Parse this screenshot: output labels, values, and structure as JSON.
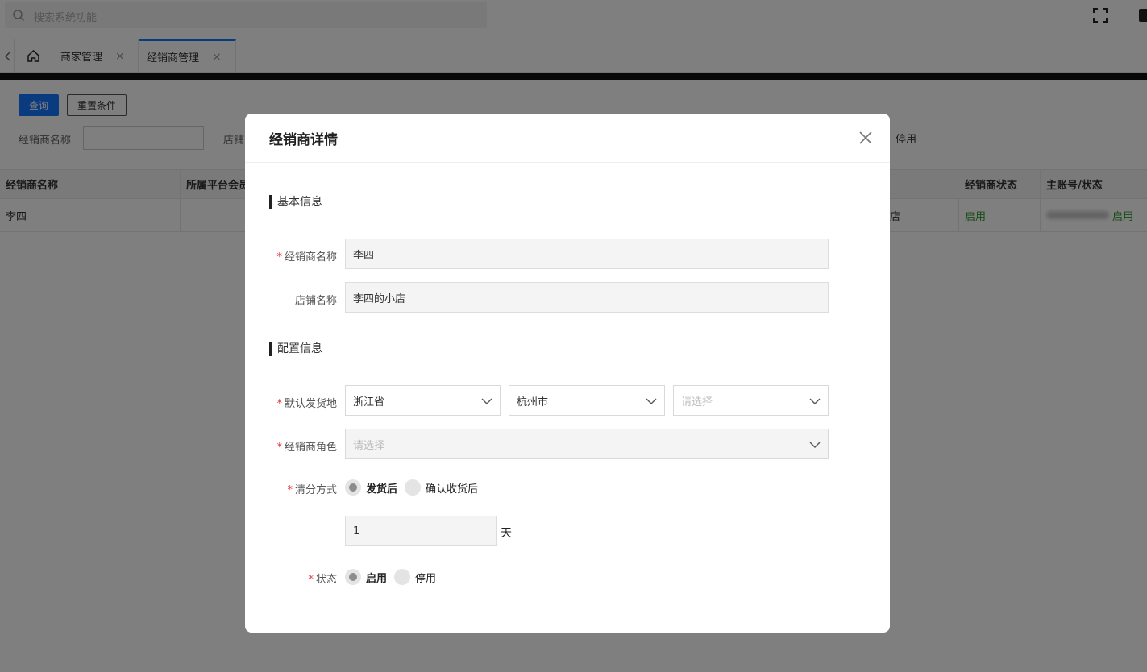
{
  "topbar": {
    "search_placeholder": "搜索系统功能",
    "search_icon": "search-icon",
    "fullscreen_icon": "fullscreen-icon"
  },
  "tabs": {
    "prev_icon": "chevron-left-icon",
    "home_icon": "home-icon",
    "items": [
      {
        "label": "商家管理",
        "close": "×"
      },
      {
        "label": "经销商管理",
        "close": "×"
      }
    ]
  },
  "filters": {
    "query_label": "查询",
    "reset_label": "重置条件",
    "dealer_name_label": "经销商名称",
    "store_label_partial": "店铺",
    "stop_label": "停用"
  },
  "table": {
    "headers": [
      "经销商名称",
      "所属平台会员",
      "经销商状态",
      "主账号/状态"
    ],
    "rows": [
      {
        "dealer": "李四",
        "platform": "",
        "partial": "店",
        "status": "启用",
        "account_status": "启用"
      }
    ]
  },
  "modal": {
    "title": "经销商详情",
    "close_icon": "close-icon",
    "section_basic": "基本信息",
    "section_config": "配置信息",
    "dealer_name": {
      "label": "经销商名称",
      "required": "*",
      "value": "李四"
    },
    "store_name": {
      "label": "店铺名称",
      "value": "李四的小店"
    },
    "ship_from": {
      "label": "默认发货地",
      "required": "*",
      "province": "浙江省",
      "city": "杭州市",
      "district_placeholder": "请选择"
    },
    "dealer_role": {
      "label": "经销商角色",
      "required": "*",
      "placeholder": "请选择"
    },
    "settle": {
      "label": "清分方式",
      "required": "*",
      "options": [
        "发货后",
        "确认收货后"
      ],
      "selected": "发货后",
      "days_value": "1",
      "days_unit": "天"
    },
    "status": {
      "label": "状态",
      "required": "*",
      "options": [
        "启用",
        "停用"
      ],
      "selected": "启用"
    }
  },
  "colors": {
    "primary": "#1677ff",
    "enabled_green": "#2e9b2e",
    "required_red": "#e53935"
  }
}
